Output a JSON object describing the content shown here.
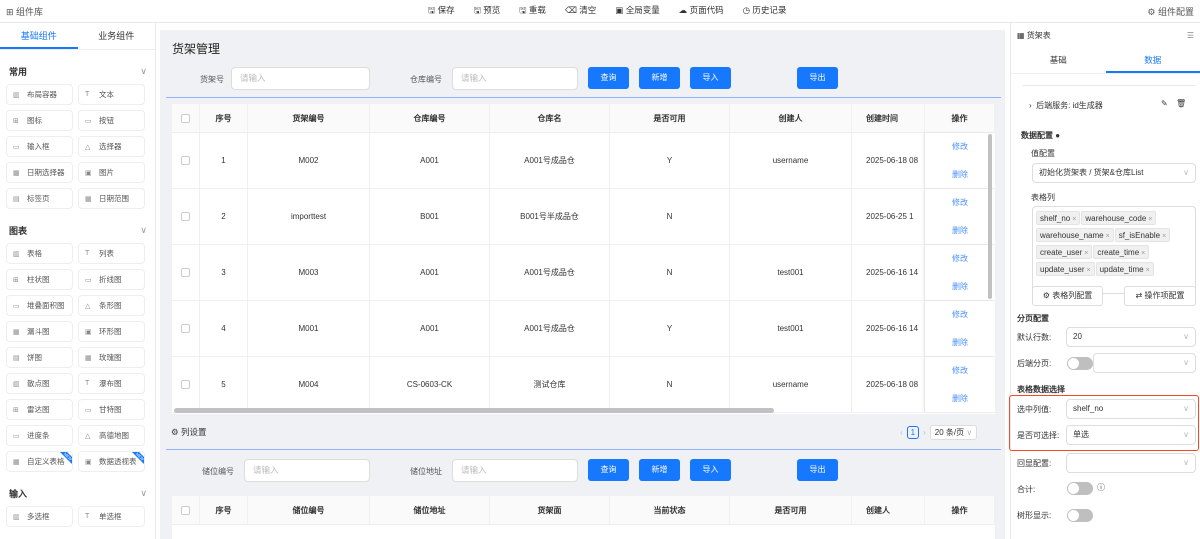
{
  "topbar": {
    "library": "组件库",
    "tools": [
      "保存",
      "预览",
      "重载",
      "清空",
      "全局变量",
      "页面代码",
      "历史记录"
    ],
    "config": "组件配置"
  },
  "left": {
    "tabs": [
      "基础组件",
      "业务组件"
    ],
    "sections": [
      {
        "title": "常用",
        "items": [
          "布局容器",
          "文本",
          "图标",
          "按钮",
          "输入框",
          "选择器",
          "日期选择器",
          "图片",
          "标签页",
          "日期范围"
        ]
      },
      {
        "title": "图表",
        "items": [
          "表格",
          "列表",
          "柱状图",
          "折线图",
          "堆叠面积图",
          "条形图",
          "漏斗图",
          "环形图",
          "饼图",
          "玫瑰图",
          "散点图",
          "瀑布图",
          "雷达图",
          "甘特图",
          "进度条",
          "高德地图",
          "自定义表格",
          "数据透视表"
        ]
      },
      {
        "title": "输入",
        "items": [
          "多选框",
          "单选框"
        ]
      }
    ]
  },
  "main": {
    "title": "货架管理",
    "form1": {
      "label1": "货架号",
      "label2": "仓库编号",
      "placeholder": "请输入"
    },
    "form2": {
      "label1": "储位编号",
      "label2": "储位地址",
      "placeholder": "请输入"
    },
    "buttons": {
      "query": "查询",
      "add": "新增",
      "import": "导入",
      "export": "导出"
    },
    "table1": {
      "headers": [
        "序号",
        "货架编号",
        "仓库编号",
        "仓库名",
        "是否可用",
        "创建人",
        "创建时间",
        "操作"
      ],
      "rows": [
        [
          "1",
          "M002",
          "A001",
          "A001号成品仓",
          "Y",
          "username",
          "2025-06-18 08"
        ],
        [
          "2",
          "importtest",
          "B001",
          "B001号半成品仓",
          "N",
          "",
          "2025-06-25 1"
        ],
        [
          "3",
          "M003",
          "A001",
          "A001号成品仓",
          "N",
          "test001",
          "2025-06-16 14"
        ],
        [
          "4",
          "M001",
          "A001",
          "A001号成品仓",
          "Y",
          "test001",
          "2025-06-16 14"
        ],
        [
          "5",
          "M004",
          "CS-0603-CK",
          "测试仓库",
          "N",
          "username",
          "2025-06-18 08"
        ]
      ],
      "edit": "修改",
      "delete": "删除"
    },
    "column_settings": "列设置",
    "pagination": {
      "page": "1",
      "page_size": "20 条/页"
    },
    "table2": {
      "headers": [
        "序号",
        "储位编号",
        "储位地址",
        "货架面",
        "当前状态",
        "是否可用",
        "创建人",
        "操作"
      ]
    }
  },
  "right": {
    "title": "货架表",
    "tabs": [
      "基础",
      "数据"
    ],
    "service": "后端服务: id生成器",
    "data_config": "数据配置",
    "value_config": "值配置",
    "value_select": "初始化货架表 / 货架&仓库List",
    "columns_label": "表格列",
    "columns": [
      "shelf_no",
      "warehouse_code",
      "warehouse_name",
      "sf_isEnable",
      "create_user",
      "create_time",
      "update_user",
      "update_time"
    ],
    "col_config_btn": "表格列配置",
    "op_config_btn": "操作项配置",
    "paging": "分页配置",
    "default_rows_label": "默认行数:",
    "default_rows": "20",
    "backend_paging": "后端分页:",
    "selection": "表格数据选择",
    "selected_col_label": "选中列值:",
    "selected_col": "shelf_no",
    "selectable_label": "是否可选择:",
    "selectable": "单选",
    "echo_label": "回显配置:",
    "sum_label": "合计:",
    "tree_label": "树形显示:"
  }
}
